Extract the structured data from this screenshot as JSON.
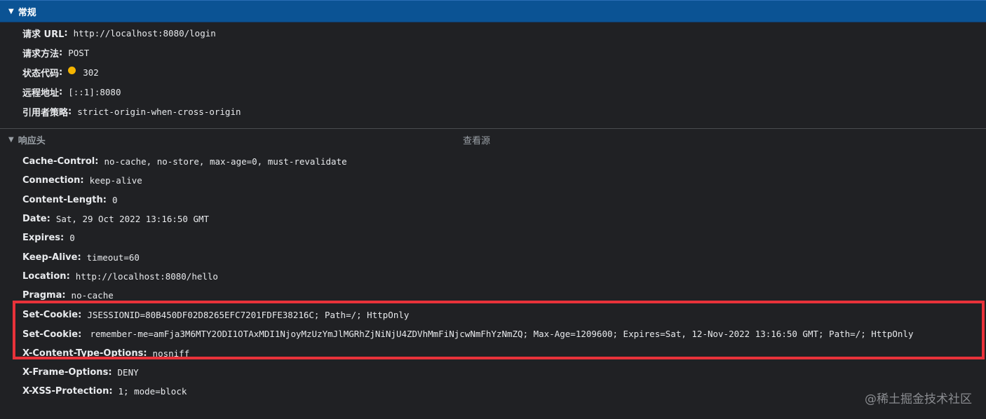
{
  "general": {
    "title": "常规",
    "rows": [
      {
        "key": "请求 URL",
        "value": "http://localhost:8080/login"
      },
      {
        "key": "请求方法",
        "value": "POST"
      },
      {
        "key": "状态代码",
        "value": "302"
      },
      {
        "key": "远程地址",
        "value": "[::1]:8080"
      },
      {
        "key": "引用者策略",
        "value": "strict-origin-when-cross-origin"
      }
    ]
  },
  "response_headers": {
    "title": "响应头",
    "view_source": "查看源",
    "rows": [
      {
        "key": "Cache-Control",
        "value": "no-cache, no-store, max-age=0, must-revalidate"
      },
      {
        "key": "Connection",
        "value": "keep-alive"
      },
      {
        "key": "Content-Length",
        "value": "0"
      },
      {
        "key": "Date",
        "value": "Sat, 29 Oct 2022 13:16:50 GMT"
      },
      {
        "key": "Expires",
        "value": "0"
      },
      {
        "key": "Keep-Alive",
        "value": "timeout=60"
      },
      {
        "key": "Location",
        "value": "http://localhost:8080/hello"
      },
      {
        "key": "Pragma",
        "value": "no-cache"
      },
      {
        "key": "Set-Cookie",
        "value": "JSESSIONID=80B450DF02D8265EFC7201FDFE38216C; Path=/; HttpOnly"
      },
      {
        "key": "Set-Cookie",
        "value": "remember-me=amFja3M6MTY2ODI1OTAxMDI1NjoyMzUzYmJlMGRhZjNiNjU4ZDVhMmFiNjcwNmFhYzNmZQ; Max-Age=1209600; Expires=Sat, 12-Nov-2022 13:16:50 GMT; Path=/; HttpOnly"
      },
      {
        "key": "X-Content-Type-Options",
        "value": "nosniff"
      },
      {
        "key": "X-Frame-Options",
        "value": "DENY"
      },
      {
        "key": "X-XSS-Protection",
        "value": "1; mode=block"
      }
    ]
  },
  "watermark": "@稀土掘金技术社区",
  "colors": {
    "accent": "#0b5394",
    "highlight": "#e8323a",
    "status_warning": "#f4b400"
  }
}
